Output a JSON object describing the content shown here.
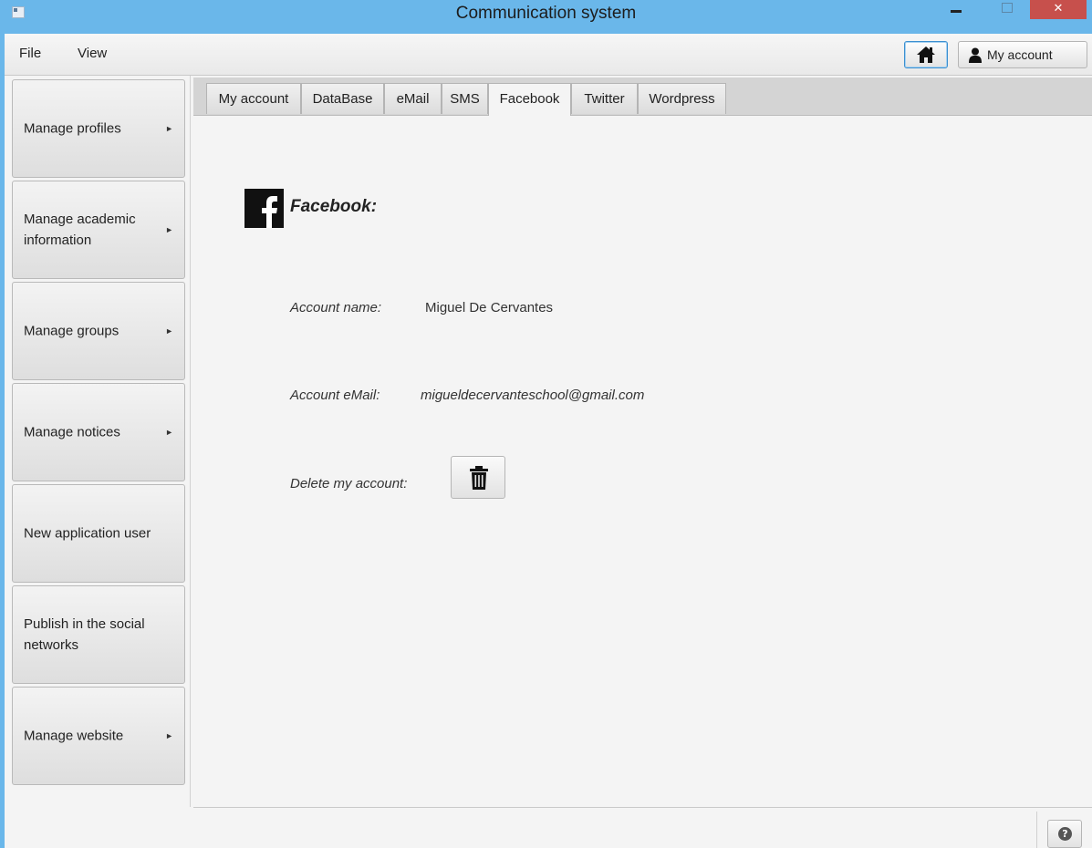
{
  "window": {
    "title": "Communication system",
    "close_glyph": "✕"
  },
  "menubar": {
    "file_label": "File",
    "view_label": "View",
    "home_icon": "home-icon",
    "account_label": "My account"
  },
  "sidebar": {
    "items": [
      {
        "label": "Manage profiles",
        "has_arrow": true
      },
      {
        "label": "Manage academic information",
        "has_arrow": true
      },
      {
        "label": "Manage groups",
        "has_arrow": true
      },
      {
        "label": "Manage notices",
        "has_arrow": true
      },
      {
        "label": "New application user",
        "has_arrow": false
      },
      {
        "label": "Publish in the social networks",
        "has_arrow": false
      },
      {
        "label": "Manage website",
        "has_arrow": true
      }
    ],
    "arrow_glyph": "►"
  },
  "tabs": [
    {
      "label": "My account",
      "active": false
    },
    {
      "label": "DataBase",
      "active": false
    },
    {
      "label": "eMail",
      "active": false
    },
    {
      "label": "SMS",
      "active": false
    },
    {
      "label": "Facebook",
      "active": true
    },
    {
      "label": "Twitter",
      "active": false
    },
    {
      "label": "Wordpress",
      "active": false
    }
  ],
  "facebook": {
    "title": "Facebook:",
    "account_name_label": "Account name:",
    "account_name_value": "Miguel De Cervantes",
    "account_email_label": "Account eMail:",
    "account_email_value": "migueldecervanteschool@gmail.com",
    "delete_label": "Delete my account:"
  },
  "footer": {
    "help_glyph": "?"
  },
  "colors": {
    "titlebar": "#6ab7ea",
    "close": "#c7504c",
    "focus_border": "#3b8fd0"
  }
}
